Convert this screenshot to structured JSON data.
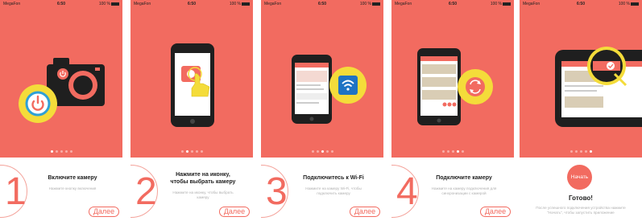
{
  "status": {
    "carrier": "MegaFon",
    "time": "6:50",
    "battery": "100 %"
  },
  "screens": [
    {
      "number": "1",
      "title": "Включите камеру",
      "subtitle": "Нажмите кнопку включения",
      "next_label": "Далее"
    },
    {
      "number": "2",
      "title": "Нажмите на иконку,\nчтобы выбрать камеру",
      "subtitle": "Нажмите на иконку, чтобы выбрать\nкамеру",
      "next_label": "Далее"
    },
    {
      "number": "3",
      "title": "Подключитесь к Wi-Fi",
      "subtitle": "Нажмите на камеру Wi-Fi, чтобы\nподключить камеру",
      "next_label": "Далее"
    },
    {
      "number": "4",
      "title": "Подключите камеру",
      "subtitle": "Нажмите на камеру подключения для\nсинхронизации с камерой",
      "next_label": "Далее"
    }
  ],
  "final": {
    "start_label": "Начать",
    "title": "Готово!",
    "subtitle": "После успешного подключения устройства нажмите\n\"Начать\", чтобы запустить приложение"
  },
  "pagination": {
    "total": 5,
    "active_per_screen": [
      1,
      2,
      3,
      4,
      5
    ]
  },
  "colors": {
    "accent": "#f26b60",
    "highlight": "#f4dc3a",
    "dark": "#1f1f1f"
  },
  "icons": [
    "camera-icon",
    "power-icon",
    "touch-hand-icon",
    "wifi-icon",
    "sync-icon",
    "checkmark-icon"
  ]
}
